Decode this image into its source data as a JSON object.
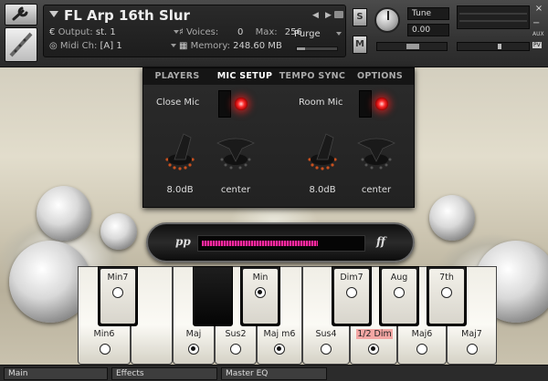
{
  "header": {
    "instrument_name": "FL Arp 16th Slur",
    "output_label": "Output:",
    "output_value": "st. 1",
    "midi_label": "Midi Ch:",
    "midi_value": "[A]  1",
    "voices_label": "Voices:",
    "voices_value": "0",
    "max_label": "Max:",
    "max_value": "256",
    "memory_label": "Memory:",
    "memory_value": "248.60 MB",
    "purge_label": "Purge",
    "solo_label": "S",
    "mute_label": "M",
    "tune_label": "Tune",
    "tune_value": "0.00",
    "close_glyph": "×",
    "aux_tag": "AUX",
    "pv_tag": "PV",
    "minus_glyph": "−"
  },
  "tabs": [
    {
      "label": "PLAYERS",
      "active": false
    },
    {
      "label": "MIC SETUP",
      "active": true
    },
    {
      "label": "TEMPO SYNC",
      "active": false
    },
    {
      "label": "OPTIONS",
      "active": false
    }
  ],
  "mic": {
    "close_label": "Close Mic",
    "room_label": "Room Mic",
    "close_volume": "8.0dB",
    "close_pan": "center",
    "room_volume": "8.0dB",
    "room_pan": "center"
  },
  "dynamics": {
    "low_label": "pp",
    "high_label": "ff",
    "level": 0.72
  },
  "chords": {
    "black": [
      {
        "label": "Min7",
        "selected": false
      },
      {
        "label": "Min",
        "selected": true
      },
      {
        "label": "Dim7",
        "selected": false
      },
      {
        "label": "Aug",
        "selected": false
      },
      {
        "label": "7th",
        "selected": false
      }
    ],
    "white": [
      {
        "label": "Min6",
        "selected": false
      },
      {
        "label": "Maj",
        "selected": true
      },
      {
        "label": "Sus2",
        "selected": false
      },
      {
        "label": "Maj m6",
        "selected": true
      },
      {
        "label": "Sus4",
        "selected": false
      },
      {
        "label": "1/2 Dim",
        "selected": true
      },
      {
        "label": "Maj6",
        "selected": false
      },
      {
        "label": "Maj7",
        "selected": false
      }
    ]
  },
  "statusbar": {
    "tabs": [
      "Main",
      "Effects",
      "Master EQ"
    ]
  },
  "colors": {
    "led": "#ff2a2a",
    "meter": "#ff2aa0",
    "highlight": "#f4a7a4"
  }
}
